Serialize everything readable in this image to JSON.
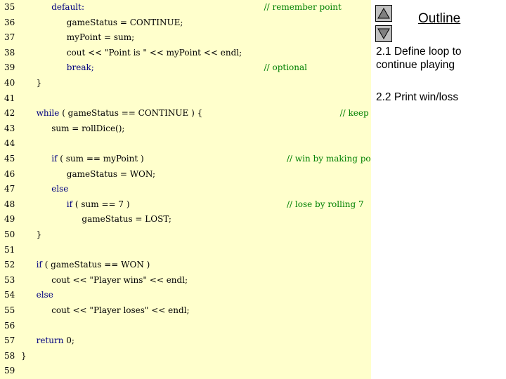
{
  "outline": {
    "title": "Outline",
    "items": [
      "2.1 Define loop to continue playing",
      "2.2 Print win/loss"
    ]
  },
  "code_lines": [
    {
      "n": "35",
      "segs": [
        {
          "t": "default:",
          "kw": true
        }
      ],
      "indent": 4,
      "comment": "// remember point",
      "comment_col": 32
    },
    {
      "n": "36",
      "segs": [
        {
          "t": "gameStatus = CONTINUE;"
        }
      ],
      "indent": 6
    },
    {
      "n": "37",
      "segs": [
        {
          "t": "myPoint = sum;"
        }
      ],
      "indent": 6
    },
    {
      "n": "38",
      "segs": [
        {
          "t": "cout << \"Point is \" << myPoint << endl;"
        }
      ],
      "indent": 6
    },
    {
      "n": "39",
      "segs": [
        {
          "t": "break;",
          "kw": true
        }
      ],
      "indent": 6,
      "comment": "// optional",
      "comment_col": 32
    },
    {
      "n": "40",
      "segs": [
        {
          "t": "}"
        }
      ],
      "indent": 2
    },
    {
      "n": "41",
      "segs": [],
      "indent": 0
    },
    {
      "n": "42",
      "segs": [
        {
          "t": "while",
          "kw": true
        },
        {
          "t": " ( gameStatus == CONTINUE ) {"
        }
      ],
      "indent": 2,
      "comment": "// keep rolling",
      "comment_col": 42
    },
    {
      "n": "43",
      "segs": [
        {
          "t": "sum = rollDice();"
        }
      ],
      "indent": 4
    },
    {
      "n": "44",
      "segs": [],
      "indent": 0
    },
    {
      "n": "45",
      "segs": [
        {
          "t": "if",
          "kw": true
        },
        {
          "t": " ( sum == myPoint )"
        }
      ],
      "indent": 4,
      "comment": "// win by making point",
      "comment_col": 35
    },
    {
      "n": "46",
      "segs": [
        {
          "t": "gameStatus = WON;"
        }
      ],
      "indent": 6
    },
    {
      "n": "47",
      "segs": [
        {
          "t": "else",
          "kw": true
        }
      ],
      "indent": 4
    },
    {
      "n": "48",
      "segs": [
        {
          "t": "if",
          "kw": true
        },
        {
          "t": " ( sum == 7 )"
        }
      ],
      "indent": 6,
      "comment": "// lose by rolling 7",
      "comment_col": 35
    },
    {
      "n": "49",
      "segs": [
        {
          "t": "gameStatus = LOST;"
        }
      ],
      "indent": 8
    },
    {
      "n": "50",
      "segs": [
        {
          "t": "}"
        }
      ],
      "indent": 2
    },
    {
      "n": "51",
      "segs": [],
      "indent": 0
    },
    {
      "n": "52",
      "segs": [
        {
          "t": "if",
          "kw": true
        },
        {
          "t": " ( gameStatus == WON )"
        }
      ],
      "indent": 2
    },
    {
      "n": "53",
      "segs": [
        {
          "t": "cout << \"Player wins\" << endl;"
        }
      ],
      "indent": 4
    },
    {
      "n": "54",
      "segs": [
        {
          "t": "else",
          "kw": true
        }
      ],
      "indent": 2
    },
    {
      "n": "55",
      "segs": [
        {
          "t": "cout << \"Player loses\" << endl;"
        }
      ],
      "indent": 4
    },
    {
      "n": "56",
      "segs": [],
      "indent": 0
    },
    {
      "n": "57",
      "segs": [
        {
          "t": "return",
          "kw": true
        },
        {
          "t": " 0;"
        }
      ],
      "indent": 2
    },
    {
      "n": "58",
      "segs": [
        {
          "t": "}"
        }
      ],
      "indent": 0
    },
    {
      "n": "59",
      "segs": [],
      "indent": 0
    }
  ],
  "colors": {
    "code_bg": "#ffffcc",
    "keyword": "#000080",
    "comment": "#008000"
  },
  "icons": {
    "prev": "triangle-up-icon",
    "next": "triangle-down-icon"
  }
}
